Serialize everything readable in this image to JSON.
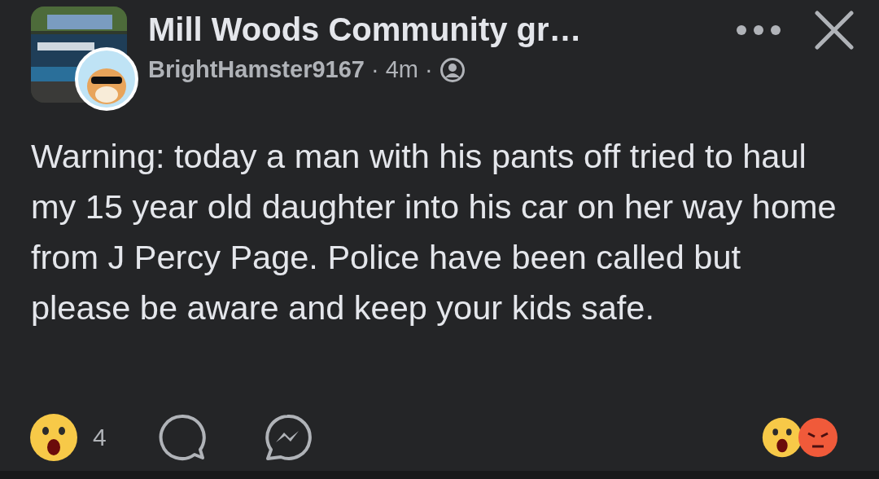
{
  "header": {
    "group_title": "Mill Woods Community gr…",
    "author": "BrightHamster9167",
    "separator_1": "·",
    "time": "4m",
    "separator_2": "·"
  },
  "post": {
    "body": "Warning: today a man with his pants off tried to haul my 15 year old daughter into his car on her way home from J Percy Page. Police have been called but please be aware and keep your kids safe."
  },
  "footer": {
    "reaction_count": "4"
  }
}
